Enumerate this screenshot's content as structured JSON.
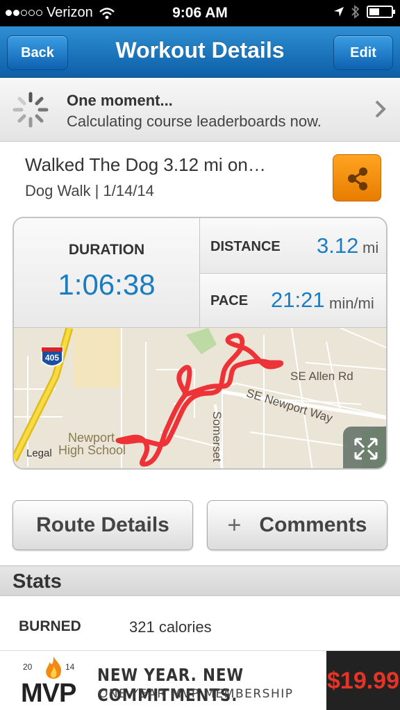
{
  "status_bar": {
    "carrier": "Verizon",
    "time": "9:06 AM"
  },
  "nav": {
    "back_label": "Back",
    "title": "Workout Details",
    "edit_label": "Edit"
  },
  "banner": {
    "title": "One moment...",
    "message": "Calculating course leaderboards now."
  },
  "workout": {
    "title": "Walked The Dog 3.12 mi on…",
    "subtitle": "Dog Walk | 1/14/14"
  },
  "stats_card": {
    "duration_label": "DURATION",
    "duration_value": "1:06:38",
    "distance_label": "DISTANCE",
    "distance_value": "3.12",
    "distance_unit": "mi",
    "pace_label": "PACE",
    "pace_value": "21:21",
    "pace_unit": "min/mi"
  },
  "map": {
    "highway_shield": "405",
    "labels": {
      "road1": "SE Allen Rd",
      "road2": "SE Newport Way",
      "road3": "Somerset",
      "school_line1": "Newport",
      "school_line2": "High School"
    },
    "legal": "Legal",
    "route_color": "#ee3338"
  },
  "actions": {
    "route_details": "Route Details",
    "comments_plus": "+",
    "comments": "Comments"
  },
  "stats": {
    "header": "Stats",
    "burned_label": "BURNED",
    "burned_value": "321 calories"
  },
  "ad": {
    "year_left": "20",
    "year_right": "14",
    "brand": "MVP",
    "headline": "NEW YEAR. NEW COMMITMENTS.",
    "subline": "ONE-YEAR MVP MEMBERSHIP",
    "price": "$19.99"
  }
}
